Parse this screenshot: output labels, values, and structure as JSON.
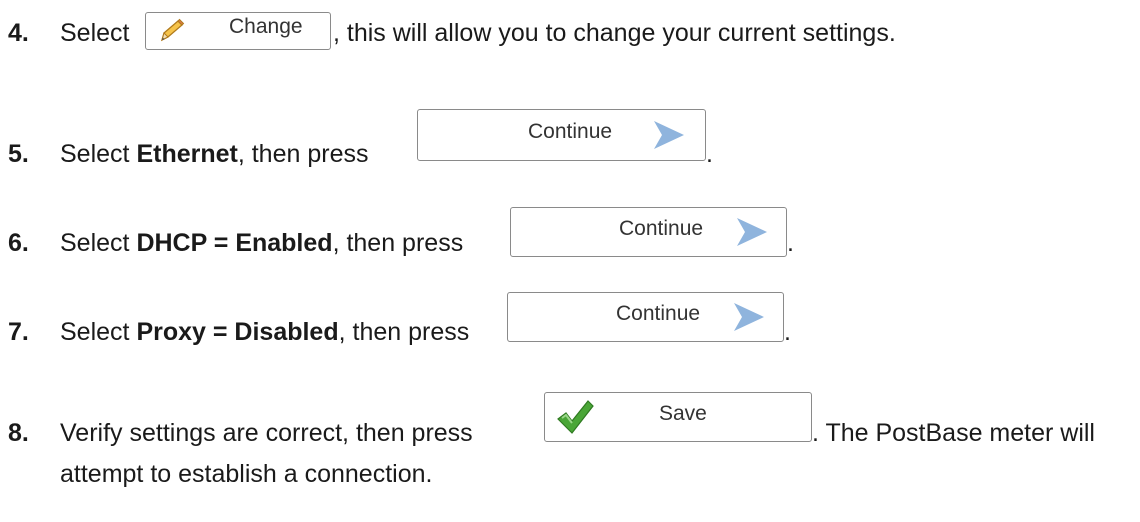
{
  "steps": [
    {
      "number": "4.",
      "text_before": "Select",
      "button": {
        "label": "Change",
        "icon": "pencil-icon"
      },
      "text_after": ", this will allow you to change your current settings."
    },
    {
      "number": "5.",
      "text_before": "Select ",
      "bold": "Ethernet",
      "text_mid": ", then press",
      "button": {
        "label": "Continue",
        "icon": "chevron-right-icon"
      },
      "text_after": "."
    },
    {
      "number": "6.",
      "text_before": "Select ",
      "bold": "DHCP = Enabled",
      "text_mid": ", then press",
      "button": {
        "label": "Continue",
        "icon": "chevron-right-icon"
      },
      "text_after": "."
    },
    {
      "number": "7.",
      "text_before": "Select ",
      "bold": "Proxy = Disabled",
      "text_mid": ", then press",
      "button": {
        "label": "Continue",
        "icon": "chevron-right-icon"
      },
      "text_after": "."
    },
    {
      "number": "8.",
      "text_before": "Verify settings are correct, then press",
      "button": {
        "label": "Save",
        "icon": "checkmark-icon"
      },
      "text_after": ". The PostBase meter will",
      "text_continued": "attempt to establish a connection."
    }
  ],
  "colors": {
    "text": "#1a1a1a",
    "button_border": "#8a8a8a",
    "chevron": "#8fb4dd",
    "checkmark": "#3d9a2a",
    "pencil": "#e8a93a"
  }
}
